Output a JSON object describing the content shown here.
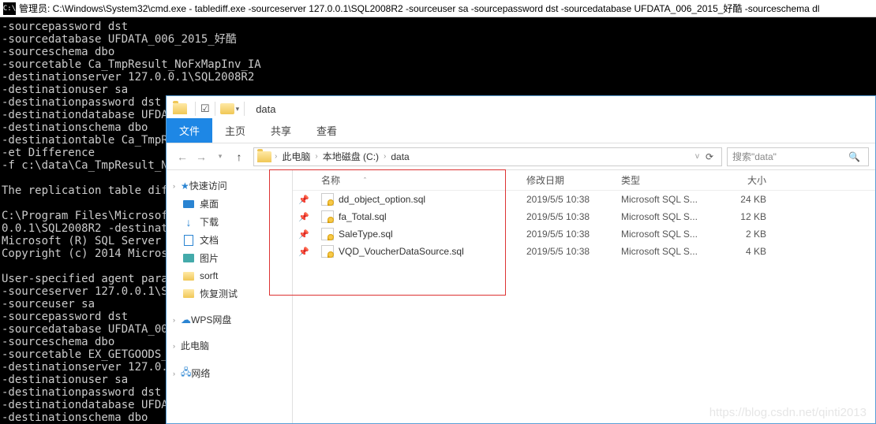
{
  "cmd": {
    "icon_text": "C:\\",
    "title": "管理员: C:\\Windows\\System32\\cmd.exe - tablediff.exe   -sourceserver 127.0.0.1\\SQL2008R2 -sourceuser sa -sourcepassword dst -sourcedatabase UFDATA_006_2015_好酷 -sourceschema dl",
    "lines": [
      "-sourcepassword dst",
      "-sourcedatabase UFDATA_006_2015_好酷",
      "-sourceschema dbo",
      "-sourcetable Ca_TmpResult_NoFxMapInv_IA",
      "-destinationserver 127.0.0.1\\SQL2008R2",
      "-destinationuser sa",
      "-destinationpassword dst",
      "-destinationdatabase UFDAT",
      "-destinationschema dbo",
      "-destinationtable Ca_TmpRe",
      "-et Difference",
      "-f c:\\data\\Ca_TmpResult_No",
      "",
      "The replication table diff",
      "",
      "C:\\Program Files\\Microsoft",
      "0.0.1\\SQL2008R2 -destinati",
      "Microsoft (R) SQL Server R",
      "Copyright (c) 2014 Microso",
      "",
      "User-specified agent param",
      "-sourceserver 127.0.0.1\\SQ",
      "-sourceuser sa",
      "-sourcepassword dst",
      "-sourcedatabase UFDATA_006",
      "-sourceschema dbo",
      "-sourcetable EX_GETGOODS_D",
      "-destinationserver 127.0.0",
      "-destinationuser sa",
      "-destinationpassword dst",
      "-destinationdatabase UFDAT",
      "-destinationschema dbo"
    ]
  },
  "explorer": {
    "titlebar_text": "data",
    "ribbon": {
      "file": "文件",
      "home": "主页",
      "share": "共享",
      "view": "查看"
    },
    "path": {
      "seg1": "此电脑",
      "seg2": "本地磁盘 (C:)",
      "seg3": "data"
    },
    "search_placeholder": "搜索\"data\"",
    "sidebar": {
      "quick": "快速访问",
      "desktop": "桌面",
      "downloads": "下载",
      "documents": "文档",
      "pictures": "图片",
      "sorft": "sorft",
      "recover": "恢复测试",
      "wps": "WPS网盘",
      "pc": "此电脑",
      "network": "网络"
    },
    "columns": {
      "name": "名称",
      "date": "修改日期",
      "type": "类型",
      "size": "大小"
    },
    "files": [
      {
        "name": "dd_object_option.sql",
        "date": "2019/5/5 10:38",
        "type": "Microsoft SQL S...",
        "size": "24 KB"
      },
      {
        "name": "fa_Total.sql",
        "date": "2019/5/5 10:38",
        "type": "Microsoft SQL S...",
        "size": "12 KB"
      },
      {
        "name": "SaleType.sql",
        "date": "2019/5/5 10:38",
        "type": "Microsoft SQL S...",
        "size": "2 KB"
      },
      {
        "name": "VQD_VoucherDataSource.sql",
        "date": "2019/5/5 10:38",
        "type": "Microsoft SQL S...",
        "size": "4 KB"
      }
    ]
  },
  "watermark": "https://blog.csdn.net/qinti2013"
}
